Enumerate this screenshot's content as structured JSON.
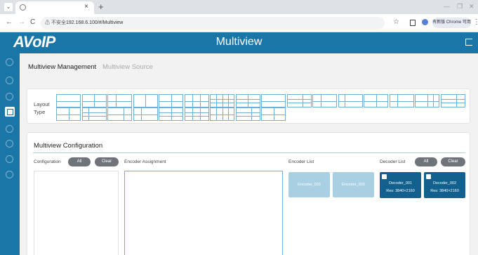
{
  "browser": {
    "tab_title": "",
    "security_label": "⚠ 不安全",
    "url": "192.168.6.100/#/Multiview",
    "update_label": "有新版 Chrome 可用"
  },
  "app": {
    "logo": "AVoIP",
    "title": "Multiview"
  },
  "tabs": {
    "management": "Multiview Management",
    "source": "Multiview Source"
  },
  "layout": {
    "label": "Layout Type"
  },
  "config": {
    "title": "Multiview Configuration",
    "configuration_label": "Configuration",
    "encoder_assignment_label": "Encoder Assignment",
    "encoder_list_label": "Encoder List",
    "decoder_list_label": "Decoder List",
    "all_label": "All",
    "clear_label": "Clear"
  },
  "encoders": [
    {
      "name": "Encoder_003"
    },
    {
      "name": "Encoder_003"
    }
  ],
  "decoders": [
    {
      "name": "Decoder_001",
      "res": "Res: 3840×2160"
    },
    {
      "name": "Decoder_002",
      "res": "Res: 3840×2160"
    }
  ],
  "colors": {
    "brand": "#1b76a8",
    "decoder_card": "#11608e",
    "encoder_card": "#a9cfe2",
    "pill": "#6e7479"
  }
}
